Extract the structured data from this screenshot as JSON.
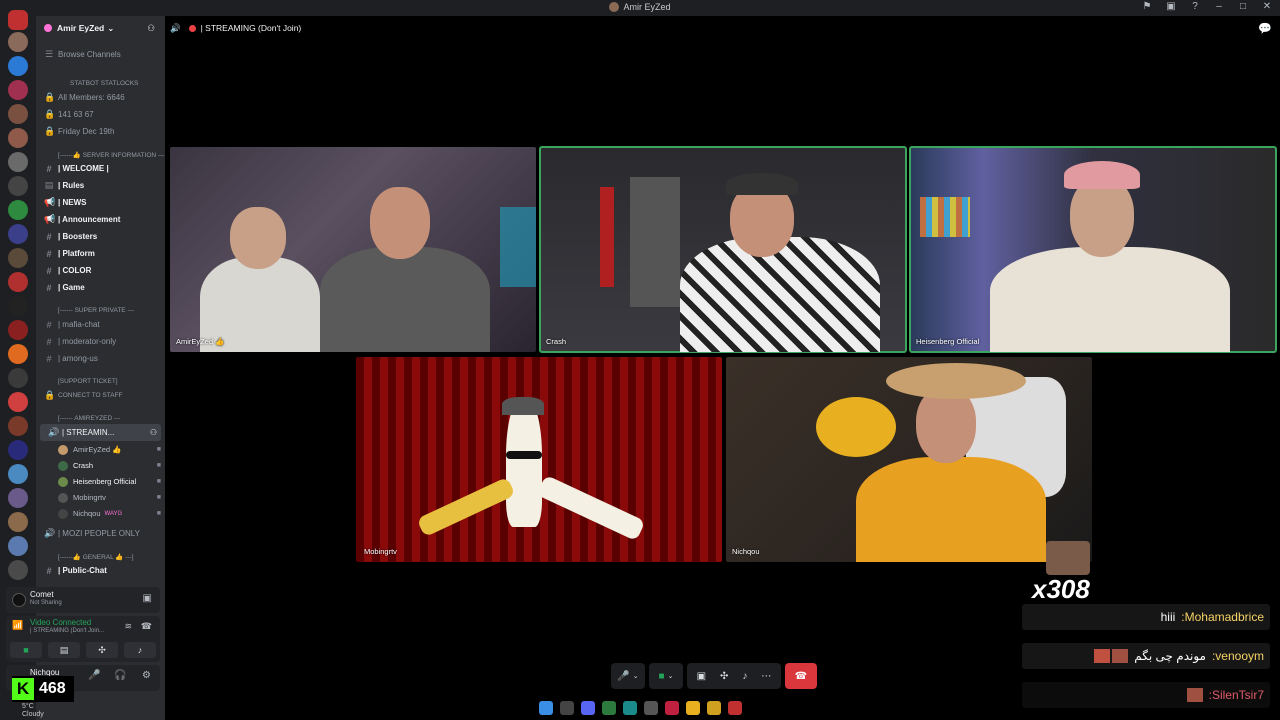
{
  "window": {
    "title": "Amir EyZed"
  },
  "server": {
    "name": "Amir EyZed",
    "browse_channels": "Browse Channels",
    "stats": {
      "category": "Statbot Statlocks",
      "members": "All Members: 6646",
      "status_counts": "141 63 67",
      "date": "Friday Dec 19th"
    }
  },
  "sidebar": {
    "server_info_category": "[------👍 SERVER INFORMATION ---",
    "channels": [
      {
        "name": "| WELCOME |",
        "bright": true
      },
      {
        "name": "| Rules"
      },
      {
        "name": "| NEWS"
      },
      {
        "name": "| Announcement"
      },
      {
        "name": "| Boosters"
      },
      {
        "name": "| Platform"
      },
      {
        "name": "| COLOR"
      },
      {
        "name": "| Game"
      }
    ],
    "super_private_category": "[------ SUPER PRIVATE ---",
    "private_channels": [
      {
        "name": "| mafia-chat"
      },
      {
        "name": "| moderator-only"
      },
      {
        "name": "| among-us"
      }
    ],
    "support_category": "[SUPPORT TICKET]",
    "support_channel": "CONNECT TO STAFF",
    "voice_category": "[------ AmirEyZed ---",
    "voice_channel": "| STREAMIN...",
    "voice_users": [
      {
        "name": "AmirEyZed 👍",
        "color": "#c49a6c"
      },
      {
        "name": "Crash",
        "color": "#3e6b47"
      },
      {
        "name": "Heisenberg Official",
        "color": "#6c8a4a"
      },
      {
        "name": "Mobingrtv",
        "color": "#555"
      },
      {
        "name": "Nichqou",
        "color": "#444"
      }
    ],
    "voice_user_badge": "WAYG",
    "mozi_channel": "| MOZI PEOPLE ONLY",
    "general_category": "[------👍 GENERAL 👍 ---]",
    "public_chat": "| Public-Chat"
  },
  "activity": {
    "name": "Comet",
    "status": "Not Sharing"
  },
  "voice_panel": {
    "status": "Video Connected",
    "channel": "| STREAMING (Don't Join..."
  },
  "user_panel": {
    "name": "Nichqou"
  },
  "kick": {
    "viewers": "468"
  },
  "weather": {
    "temp": "5°C",
    "condition": "Cloudy"
  },
  "stage": {
    "channel_title": "| STREAMING (Don't Join)"
  },
  "tiles": [
    {
      "name": "AmirEyZed 👍"
    },
    {
      "name": "Crash"
    },
    {
      "name": "Heisenberg Official"
    },
    {
      "name": "Mobingrtv"
    },
    {
      "name": "Nichqou"
    }
  ],
  "overlay": {
    "combo": "x308",
    "chat": [
      {
        "user": ":Mohamadbrice",
        "message": "hiii"
      },
      {
        "user": ":venooym",
        "message": "موندم چی بگم"
      },
      {
        "user": ":SilenTsir7",
        "message": ""
      }
    ]
  }
}
